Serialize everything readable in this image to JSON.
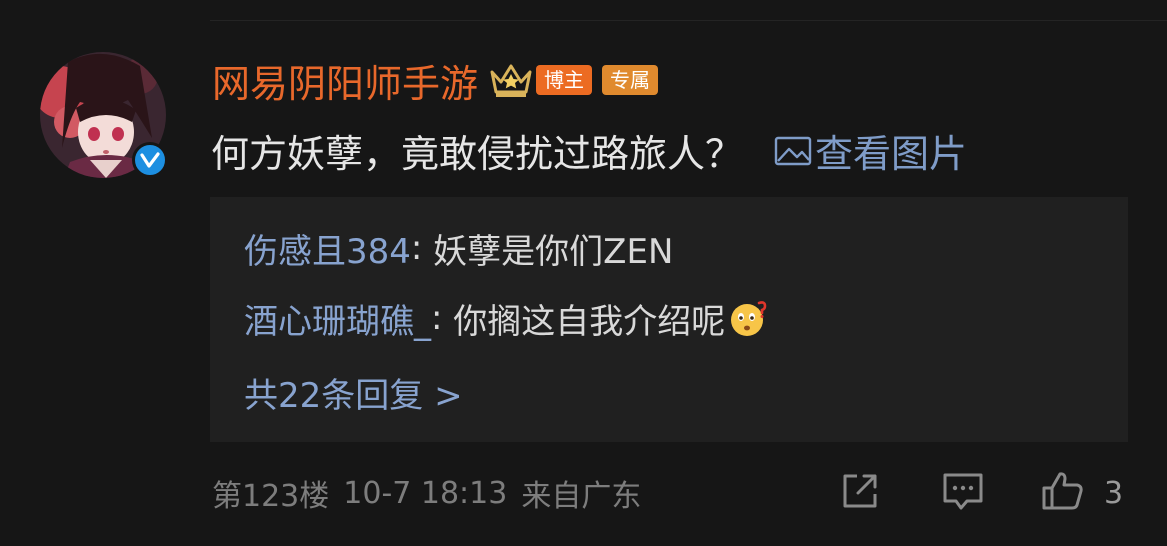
{
  "post": {
    "username": "网易阴阳师手游",
    "tags": {
      "blogger": "博主",
      "exclusive": "专属"
    },
    "text": "何方妖孽，竟敢侵扰过路旅人？",
    "view_image": "查看图片"
  },
  "replies": [
    {
      "user": "伤感且384",
      "text": "妖孽是你们ZEN"
    },
    {
      "user": "酒心珊瑚礁_",
      "text": "你搁这自我介绍呢"
    }
  ],
  "more_replies": "共22条回复 >",
  "footer": {
    "floor": "第123楼",
    "time": "10-7 18:13",
    "source": "来自广东"
  },
  "actions": {
    "like_count": "3"
  },
  "icons": {
    "avatar": "anime-girl-avatar",
    "verified": "verified-v-icon",
    "crown": "vip-crown-icon",
    "picture": "picture-icon",
    "emoji": "confused-face-emoji",
    "share": "share-icon",
    "comment": "comment-icon",
    "like": "thumbs-up-icon"
  },
  "colors": {
    "background": "#161616",
    "username": "#e8682b",
    "link": "#88a3cf",
    "verified": "#1d8fe1"
  }
}
